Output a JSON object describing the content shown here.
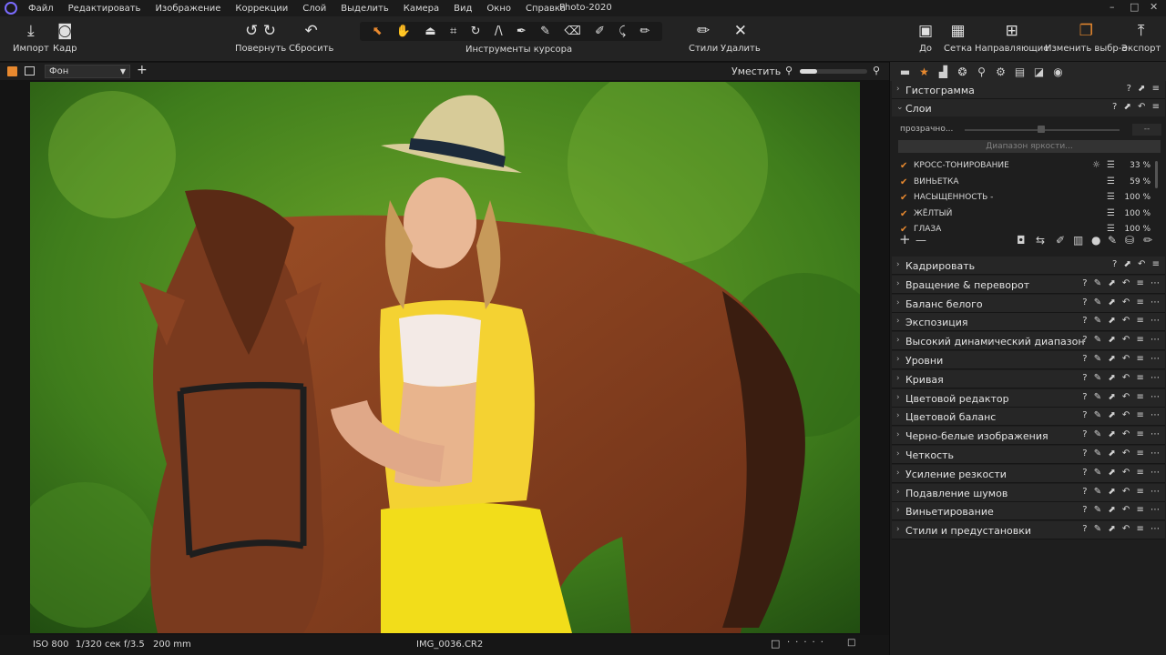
{
  "app": {
    "title": "Photo-2020",
    "menu": [
      "Файл",
      "Редактировать",
      "Изображение",
      "Коррекции",
      "Слой",
      "Выделить",
      "Камера",
      "Вид",
      "Окно",
      "Справка"
    ],
    "window_controls": [
      "–",
      "□",
      "✕"
    ]
  },
  "toolbar": {
    "import": {
      "label": "Импорт",
      "icon": "download-icon"
    },
    "capture": {
      "label": "Кадр",
      "icon": "camera-icon"
    },
    "rotate": {
      "label": "Повернуть",
      "icon": "rotate-icon"
    },
    "reset": {
      "label": "Сбросить",
      "icon": "reset-icon"
    },
    "cursor_tools_label": "Инструменты курсора",
    "cursor_tools": [
      {
        "name": "select-cursor-icon",
        "glyph": "⬉",
        "active": true
      },
      {
        "name": "pan-hand-icon",
        "glyph": "✋",
        "active": false
      },
      {
        "name": "loupe-icon",
        "glyph": "⏏",
        "active": false
      },
      {
        "name": "crop-icon",
        "glyph": "⌗",
        "active": false
      },
      {
        "name": "rotate-tool-icon",
        "glyph": "↻",
        "active": false
      },
      {
        "name": "keystone-icon",
        "glyph": "/\\",
        "active": false
      },
      {
        "name": "spot-removal-icon",
        "glyph": "✒",
        "active": false
      },
      {
        "name": "brush-icon",
        "glyph": "✎",
        "active": false
      },
      {
        "name": "eraser-icon",
        "glyph": "⌫",
        "active": false
      },
      {
        "name": "gradient-mask-icon",
        "glyph": "✐",
        "active": false
      },
      {
        "name": "color-picker-icon",
        "glyph": "⤹",
        "active": false
      },
      {
        "name": "annotate-icon",
        "glyph": "✏",
        "active": false
      }
    ],
    "styles": {
      "label": "Стили",
      "icon": "brush-icon"
    },
    "delete": {
      "label": "Удалить",
      "icon": "close-icon"
    },
    "before": {
      "label": "До",
      "icon": "before-icon"
    },
    "grid": {
      "label": "Сетка",
      "icon": "grid-icon"
    },
    "guides": {
      "label": "Направляющие",
      "icon": "guides-icon"
    },
    "edit_selection": {
      "label": "Изменить выбр-е",
      "icon": "layers-edit-icon"
    },
    "export": {
      "label": "Экспорт",
      "icon": "upload-icon"
    }
  },
  "viewer_bar": {
    "layer_select": "Фон",
    "fit_label": "Уместить",
    "zoom_fraction": 0.25
  },
  "status": {
    "iso": "ISO 800",
    "shutter": "1/320 сек",
    "aperture": "f/3.5",
    "focal": "200 mm",
    "filename": "IMG_0036.CR2"
  },
  "panel": {
    "tabs": [
      "folder-icon",
      "star-icon",
      "histogram-tab-icon",
      "color-tab-icon",
      "search-tab-icon",
      "gear-icon",
      "metadata-icon",
      "adjustments-icon",
      "circle-icon"
    ],
    "histogram_title": "Гистограмма",
    "layers": {
      "title": "Слои",
      "opacity_label": "прозрачно...",
      "opacity_value": "--",
      "brightness_range_label": "Диапазон яркости...",
      "rows": [
        {
          "name": "КРОСС-ТОНИРОВАНИЕ",
          "percent": "33 %"
        },
        {
          "name": "ВИНЬЕТКА",
          "percent": "59 %"
        },
        {
          "name": "НАСЫЩЕННОСТЬ -",
          "percent": "100 %"
        },
        {
          "name": "ЖЁЛТЫЙ",
          "percent": "100 %"
        },
        {
          "name": "ГЛАЗА",
          "percent": "100 %"
        }
      ]
    },
    "sections": [
      "Кадрировать",
      "Вращение & переворот",
      "Баланс белого",
      "Экспозиция",
      "Высокий динамический диапазон",
      "Уровни",
      "Кривая",
      "Цветовой редактор",
      "Цветовой баланс",
      "Черно-белые изображения",
      "Четкость",
      "Усиление резкости",
      "Подавление шумов",
      "Виньетирование",
      "Стили и предустановки"
    ]
  },
  "colors": {
    "accent": "#e8892f",
    "background": "#1e1e1e",
    "foliage": "#3d7a1b",
    "horse": "#7a3a1e",
    "dress": "#f2dd1a"
  }
}
